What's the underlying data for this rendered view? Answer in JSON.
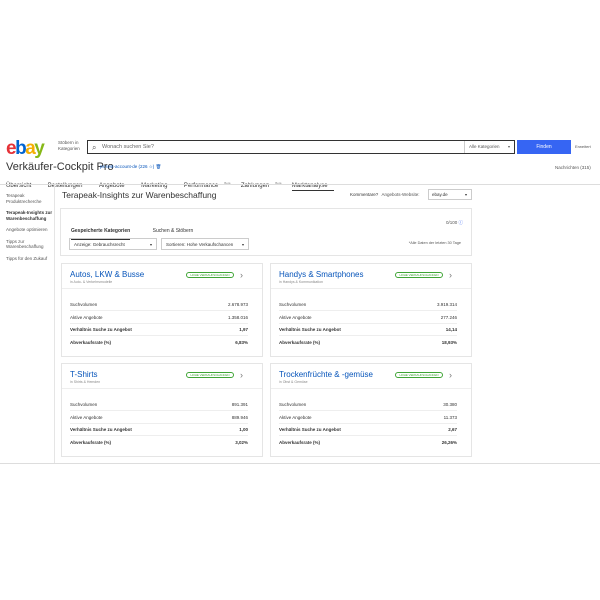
{
  "header": {
    "logo": {
      "e": "e",
      "b": "b",
      "a": "a",
      "y": "y"
    },
    "shop_by_category": "Stöbern in Kategorien",
    "search_placeholder": "Wonach suchen Sie?",
    "category_select": "Alle Kategorien",
    "find_button": "Finden",
    "advanced": "Erweitert"
  },
  "title": "Verkäufer-Cockpit Pro",
  "account": "ps-test-account-de (226 ☆)",
  "messages": "Nachrichten (315)",
  "nav": [
    {
      "label": "Übersicht",
      "sup": ""
    },
    {
      "label": "Bestellungen",
      "sup": ""
    },
    {
      "label": "Angebote",
      "sup": ""
    },
    {
      "label": "Marketing",
      "sup": ""
    },
    {
      "label": "Performance",
      "sup": "Beta"
    },
    {
      "label": "Zahlungen",
      "sup": "Beta"
    },
    {
      "label": "Marktanalyse",
      "sup": ""
    }
  ],
  "sidebar": [
    "Terapeak Produktrecherche",
    "Terapeak-Insights zur Warenbeschaffung",
    "Angebote optimieren",
    "Tipps zur Warenbeschaffung",
    "Tipps für den Zukauf"
  ],
  "main": {
    "title": "Terapeak-Insights zur Warenbeschaffung",
    "comment": "Kommentare?",
    "site_label": "Angebots-Website:",
    "site_value": "ebay.de",
    "tabs": [
      "Gespeicherte Kategorien",
      "Suchen & Stöbern"
    ],
    "counter": "0/100",
    "counter_icon": "ⓘ",
    "filter_show": "Anzeige: Gebrauchsrecht",
    "filter_sort": "Sortieren: Hohe Verkaufschancen",
    "note": "*Alle Daten der letzten 30 Tage"
  },
  "labels": {
    "search_volume": "Suchvolumen",
    "active_listings": "Aktive Angebote",
    "ratio": "Verhältnis Suche zu Angebot",
    "sell_through": "Abverkaufsrate (%)",
    "badge": "HOHE VERKAUFSCHANCEN"
  },
  "cards": [
    {
      "name": "Autos, LKW & Busse",
      "sub": "in Auto- & Verkehrsmodelle",
      "search_volume": "2.678.973",
      "active_listings": "1.358.016",
      "ratio": "1,97",
      "sell_through": "6,83%"
    },
    {
      "name": "Handys & Smartphones",
      "sub": "in Handys & Kommunikation",
      "search_volume": "3.919.314",
      "active_listings": "277.246",
      "ratio": "14,14",
      "sell_through": "18,93%"
    },
    {
      "name": "T-Shirts",
      "sub": "in Shirts & Hemden",
      "search_volume": "891.391",
      "active_listings": "889.946",
      "ratio": "1,00",
      "sell_through": "3,02%"
    },
    {
      "name": "Trockenfrüchte & -gemüse",
      "sub": "in Obst & Gemüse",
      "search_volume": "30.380",
      "active_listings": "11.373",
      "ratio": "2,67",
      "sell_through": "26,26%"
    }
  ]
}
